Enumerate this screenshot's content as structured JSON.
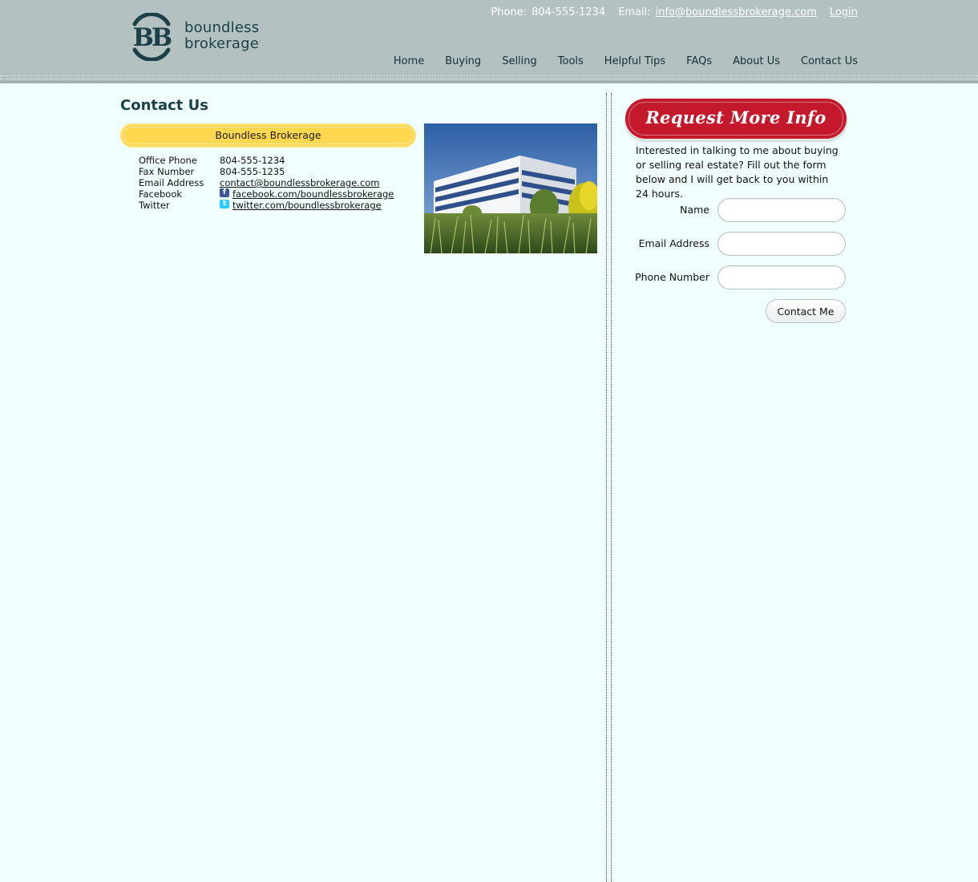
{
  "brand": {
    "name_line1": "boundless",
    "name_line2": "brokerage",
    "monogram": "BB"
  },
  "topbar": {
    "phone_label": "Phone:",
    "phone_value": "804-555-1234",
    "email_label": "Email:",
    "email_value": "info@boundlessbrokerage.com",
    "login_label": "Login"
  },
  "nav": {
    "items": [
      "Home",
      "Buying",
      "Selling",
      "Tools",
      "Helpful Tips",
      "FAQs",
      "About Us",
      "Contact Us"
    ]
  },
  "main": {
    "title": "Contact Us",
    "company_name": "Boundless Brokerage",
    "contacts": [
      {
        "label": "Office Phone",
        "value": "804-555-1234"
      },
      {
        "label": "Fax Number",
        "value": "804-555-1235"
      },
      {
        "label": "Email Address",
        "value": "contact@boundlessbrokerage.com"
      },
      {
        "label": "Facebook",
        "value": "facebook.com/boundlessbrokerage",
        "icon": "facebook-icon"
      },
      {
        "label": "Twitter",
        "value": "twitter.com/boundlessbrokerage",
        "icon": "twitter-icon"
      }
    ]
  },
  "sidebar": {
    "banner": "Request More Info",
    "intro": "Interested in talking to me about buying or selling real estate? Fill out the form below and I will get back to you within 24 hours.",
    "fields": [
      {
        "label": "Name",
        "value": ""
      },
      {
        "label": "Email Address",
        "value": ""
      },
      {
        "label": "Phone Number",
        "value": ""
      }
    ],
    "submit_label": "Contact Me"
  },
  "colors": {
    "page_bg": "#f0fffe",
    "header_bg": "#b3c1c0",
    "accent_yellow": "#ffd84f",
    "accent_red": "#c4192d",
    "text_dark": "#1d3f47"
  }
}
